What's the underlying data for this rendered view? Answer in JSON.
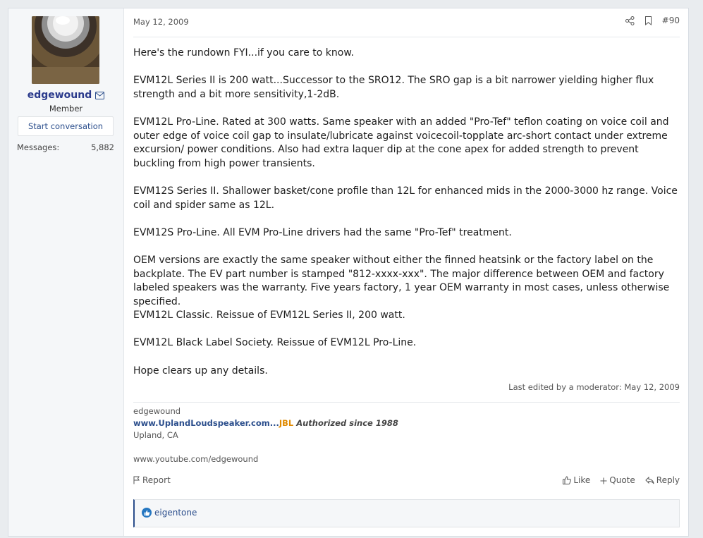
{
  "user": {
    "name": "edgewound",
    "role": "Member",
    "start_conversation": "Start conversation",
    "stats": [
      {
        "label": "Messages:",
        "value": "5,882"
      }
    ]
  },
  "post": {
    "date": "May 12, 2009",
    "number": "#90",
    "paragraphs": [
      "Here's the rundown FYI...if you care to know.",
      "EVM12L Series II is 200 watt...Successor to the SRO12. The SRO gap is a bit narrower yielding higher flux strength and a bit more sensitivity,1-2dB.",
      "EVM12L Pro-Line. Rated at 300 watts. Same speaker with an added \"Pro-Tef\" teflon coating on voice coil and outer edge of voice coil gap to insulate/lubricate against voicecoil-topplate arc-short contact under extreme excursion/ power conditions. Also had extra laquer dip at the cone apex for added strength to prevent buckling from high power transients.",
      "EVM12S Series II. Shallower basket/cone profile than 12L for enhanced mids in the 2000-3000 hz range. Voice coil and spider same as 12L.",
      "EVM12S Pro-Line. All EVM Pro-Line drivers had the same \"Pro-Tef\" treatment.",
      "OEM versions are exactly the same speaker without either the finned heatsink or the factory label on the backplate. The EV part number is stamped \"812-xxxx-xxx\". The major difference between OEM and factory labeled speakers was the warranty. Five years factory, 1 year OEM warranty in most cases, unless otherwise specified.",
      "EVM12L Classic. Reissue of EVM12L Series II, 200 watt.",
      "EVM12L Black Label Society. Reissue of EVM12L Pro-Line.",
      "Hope clears up any details."
    ],
    "edited": "Last edited by a moderator: May 12, 2009"
  },
  "signature": {
    "name": "edgewound",
    "site": "www.UplandLoudspeaker.com...",
    "jbl": "JBL",
    "authorized": " Authorized since 1988",
    "location": "Upland, CA",
    "youtube": "www.youtube.com/edgewound"
  },
  "actions": {
    "report": "Report",
    "like": "Like",
    "quote": "Quote",
    "reply": "Reply"
  },
  "reactions": {
    "users": "eigentone"
  },
  "colors": {
    "accent": "#2b4e8c",
    "username": "#2a3a8c",
    "jbl": "#e08a00",
    "like_badge": "#2577c1"
  }
}
